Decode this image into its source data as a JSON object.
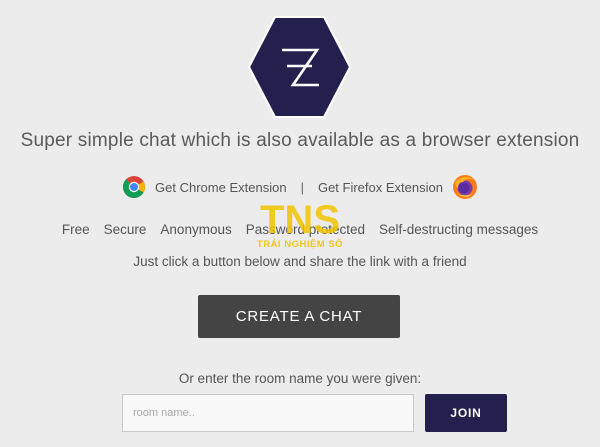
{
  "tagline": "Super simple chat which is also available as a browser extension",
  "extensions": {
    "chrome_label": "Get Chrome Extension",
    "separator": "|",
    "firefox_label": "Get Firefox Extension"
  },
  "features": [
    "Free",
    "Secure",
    "Anonymous",
    "Password protected",
    "Self-destructing messages"
  ],
  "instruction": "Just click a button below and share the link with a friend",
  "create_button": "CREATE A CHAT",
  "room": {
    "label": "Or enter the room name you were given:",
    "placeholder": "room name..",
    "value": "",
    "join_button": "JOIN"
  },
  "watermark": {
    "main": "TNS",
    "sub": "TRẢI NGHIỆM SỐ"
  },
  "colors": {
    "logo_fill": "#23204e",
    "create_button": "#444444",
    "join_button": "#23204e",
    "background": "#ececec",
    "watermark": "#f2c300"
  },
  "icons": {
    "logo": "z-hexagon-logo",
    "chrome": "chrome-icon",
    "firefox": "firefox-icon"
  }
}
